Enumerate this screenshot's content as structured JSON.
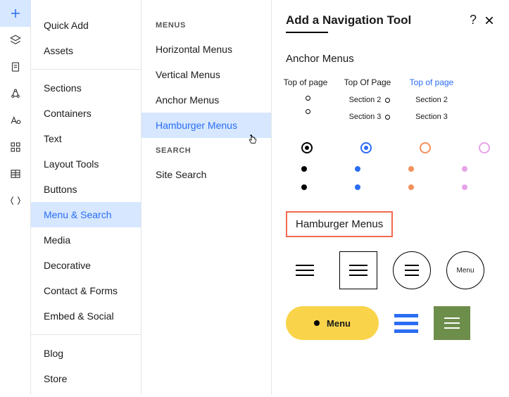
{
  "rail": {
    "icons": [
      "plus-icon",
      "layers-icon",
      "page-icon",
      "webhook-icon",
      "typography-icon",
      "grid-icon",
      "table-icon",
      "code-icon"
    ]
  },
  "sidebar1": {
    "groups": [
      {
        "items": [
          {
            "label": "Quick Add"
          },
          {
            "label": "Assets"
          }
        ]
      },
      {
        "items": [
          {
            "label": "Sections"
          },
          {
            "label": "Containers"
          },
          {
            "label": "Text"
          },
          {
            "label": "Layout Tools"
          },
          {
            "label": "Buttons"
          },
          {
            "label": "Menu & Search",
            "active": true
          },
          {
            "label": "Media"
          },
          {
            "label": "Decorative"
          },
          {
            "label": "Contact & Forms"
          },
          {
            "label": "Embed & Social"
          }
        ]
      },
      {
        "items": [
          {
            "label": "Blog"
          },
          {
            "label": "Store"
          }
        ]
      }
    ]
  },
  "sidebar2": {
    "groups": [
      {
        "heading": "MENUS",
        "items": [
          {
            "label": "Horizontal Menus"
          },
          {
            "label": "Vertical Menus"
          },
          {
            "label": "Anchor Menus"
          },
          {
            "label": "Hamburger Menus",
            "active": true
          }
        ]
      },
      {
        "heading": "SEARCH",
        "items": [
          {
            "label": "Site Search"
          }
        ]
      }
    ]
  },
  "main": {
    "title": "Add a Navigation Tool",
    "help": "?",
    "anchor_heading": "Anchor Menus",
    "anchor_cols": [
      {
        "top": "Top of page",
        "sections": [
          "",
          ""
        ],
        "style": "dots"
      },
      {
        "top": "Top Of Page",
        "sections": [
          "Section 2",
          "Section 3"
        ],
        "style": "dots"
      },
      {
        "top": "Top of page",
        "sections": [
          "Section 2",
          "Section 3"
        ],
        "style": "blue"
      }
    ],
    "hamburger_heading": "Hamburger Menus",
    "menu_text": "Menu",
    "pill_text": "Menu"
  }
}
